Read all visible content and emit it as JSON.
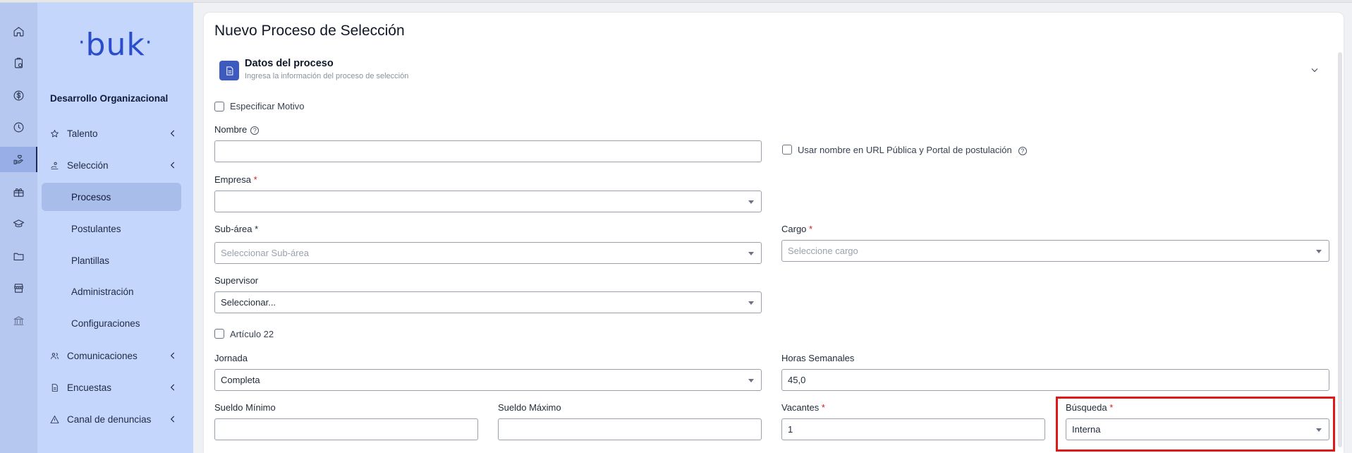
{
  "rail": {
    "icons": [
      "home-icon",
      "clipboard-clock-icon",
      "dollar-icon",
      "clock-icon",
      "hand-heart-icon",
      "gift-icon",
      "graduation-cap-icon",
      "folder-icon",
      "store-icon",
      "bank-icon"
    ],
    "active_index": 4
  },
  "sidebar": {
    "logo_text": "buk",
    "section_title": "Desarrollo Organizacional",
    "items": [
      {
        "label": "Talento",
        "icon": "star-icon"
      },
      {
        "label": "Selección",
        "icon": "hand-user-icon"
      },
      {
        "label": "Comunicaciones",
        "icon": "people-icon"
      },
      {
        "label": "Encuestas",
        "icon": "document-icon"
      },
      {
        "label": "Canal de denuncias",
        "icon": "warning-icon"
      }
    ],
    "sub_items": [
      "Procesos",
      "Postulantes",
      "Plantillas",
      "Administración",
      "Configuraciones"
    ],
    "active_sub": "Procesos"
  },
  "page": {
    "title": "Nuevo Proceso de Selección"
  },
  "section": {
    "title": "Datos del proceso",
    "subtitle": "Ingresa la información del proceso de selección"
  },
  "form": {
    "especificar_motivo": "Especificar Motivo",
    "nombre_label": "Nombre",
    "nombre_value": "",
    "url_publica": "Usar nombre en URL Pública y Portal de postulación",
    "empresa_label": "Empresa",
    "empresa_value": "",
    "subarea_label": "Sub-área *",
    "subarea_placeholder": "Seleccionar Sub-área",
    "cargo_label": "Cargo",
    "cargo_placeholder": "Seleccione cargo",
    "supervisor_label": "Supervisor",
    "supervisor_value": "Seleccionar...",
    "articulo_22": "Artículo 22",
    "jornada_label": "Jornada",
    "jornada_value": "Completa",
    "horas_label": "Horas Semanales",
    "horas_value": "45,0",
    "sueldo_min_label": "Sueldo Mínimo",
    "sueldo_min_value": "",
    "sueldo_max_label": "Sueldo Máximo",
    "sueldo_max_value": "",
    "vacantes_label": "Vacantes",
    "vacantes_value": "1",
    "busqueda_label": "Búsqueda",
    "busqueda_value": "Interna",
    "required_mark": "*"
  },
  "colors": {
    "rail_bg": "#b6c8ef",
    "sidebar_bg": "#c4d6fb",
    "accent": "#3d5bbf",
    "logo": "#2a4ecb",
    "required": "#d11f1f",
    "highlight": "#e01818"
  }
}
